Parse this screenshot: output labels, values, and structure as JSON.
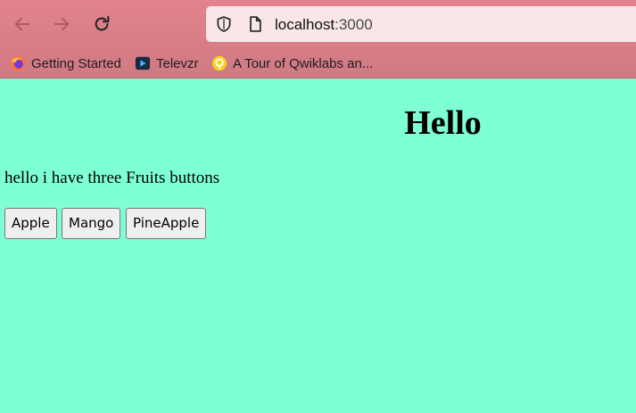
{
  "browser": {
    "url_host": "localhost",
    "url_port": ":3000",
    "bookmarks": [
      {
        "label": "Getting Started",
        "icon": "firefox-icon"
      },
      {
        "label": "Televzr",
        "icon": "televzr-icon"
      },
      {
        "label": "A Tour of Qwiklabs an...",
        "icon": "qwiklabs-icon"
      }
    ]
  },
  "page": {
    "heading": "Hello",
    "intro": "hello i have three Fruits buttons",
    "buttons": [
      "Apple",
      "Mango",
      "PineApple"
    ],
    "background": "#7fffd4"
  }
}
